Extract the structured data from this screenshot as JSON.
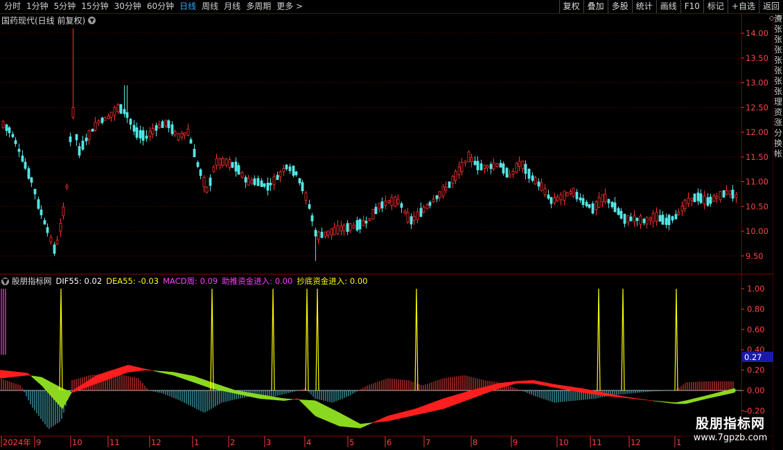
{
  "toolbar": {
    "periods": [
      "分时",
      "1分钟",
      "5分钟",
      "15分钟",
      "30分钟",
      "60分钟",
      "日线",
      "周线",
      "月线",
      "多周期",
      "更多 >"
    ],
    "active_period": "日线",
    "right_buttons": [
      "复权",
      "叠加",
      "多股",
      "统计",
      "画线",
      "F10",
      "标记",
      "+自选",
      "返回"
    ]
  },
  "main_chart": {
    "title": "国药现代(日线 前复权)",
    "price_ticks": [
      "14.00",
      "13.50",
      "13.00",
      "12.50",
      "12.00",
      "11.50",
      "11.00",
      "10.50",
      "10.00",
      "9.50"
    ],
    "price_tick_values": [
      14.0,
      13.5,
      13.0,
      12.5,
      12.0,
      11.5,
      11.0,
      10.5,
      10.0,
      9.5
    ],
    "colors": {
      "up": "#ff3232",
      "down": "#54e6e6",
      "grid": "#7a0000",
      "axis_text": "#ff4444"
    }
  },
  "indicator": {
    "name": "股朋指标网",
    "dif_label": "DIF55: 0.02",
    "dea_label": "DEA55: -0.03",
    "macd_label": "MACD周: 0.09",
    "zhutui_label": "助推资金进入: 0.00",
    "chaodi_label": "抄底资金进入: 0.00",
    "colors": {
      "dif": "#ffffff",
      "dea": "#ffff00",
      "macd": "#ff40ff",
      "zhutui": "#ff40ff",
      "chaodi": "#ffff00"
    },
    "ticks": [
      "1.00",
      "0.80",
      "0.60",
      "0.40",
      "0.20",
      "0.00",
      "-0.20"
    ],
    "tick_values": [
      1.0,
      0.8,
      0.6,
      0.4,
      0.2,
      0.0,
      -0.2
    ],
    "current_value": "0.27"
  },
  "x_axis": {
    "labels": [
      "2024年",
      "9",
      "10",
      "11",
      "12",
      "1",
      "2",
      "3",
      "4",
      "5",
      "6",
      "7",
      "8",
      "9",
      "10",
      "11",
      "12",
      "1"
    ]
  },
  "side_panel_chars": [
    "资",
    "张",
    "张",
    "张",
    "张",
    "张",
    "张",
    "张",
    "理",
    "资",
    "涨",
    "分",
    "换",
    "帐"
  ],
  "watermark": {
    "line1": "股朋指标网",
    "line2": "www.7gpzb.com"
  }
}
